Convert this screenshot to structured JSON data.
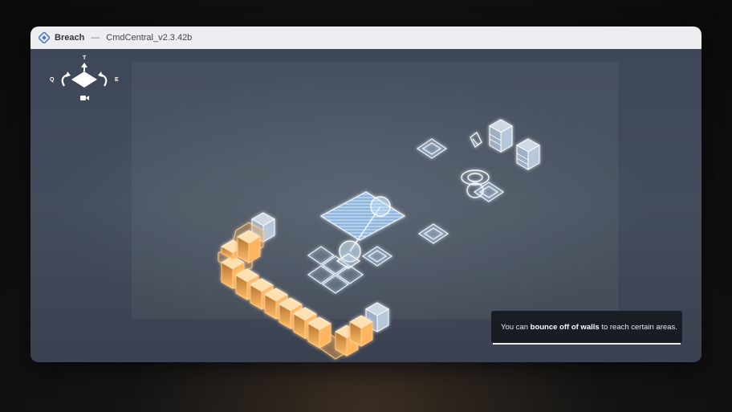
{
  "window": {
    "app_name": "Breach",
    "separator": "—",
    "file_name": "CmdCentral_v2.3.42b"
  },
  "camera_controls": {
    "top_key": "T",
    "rotate_left_key": "Q",
    "rotate_right_key": "E",
    "icons": [
      "compass-diamond-icon",
      "rotate-left-icon",
      "rotate-right-icon",
      "camera-icon"
    ]
  },
  "hint": {
    "prefix": "You can ",
    "emphasis": "bounce off of walls",
    "suffix": " to reach certain areas."
  },
  "colors": {
    "hologram_blue": "#cfe8ff",
    "wall_orange": "#f2a24a",
    "background": "#3e4758"
  }
}
